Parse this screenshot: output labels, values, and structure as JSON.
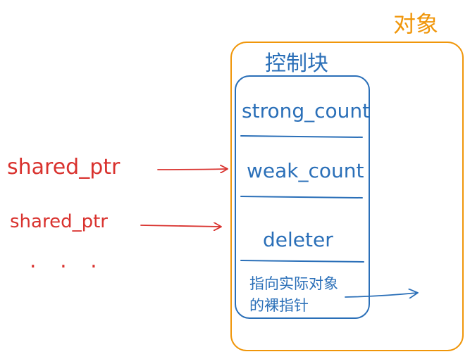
{
  "object_label": "对象",
  "control_block": {
    "title": "控制块",
    "fields": [
      "strong_count",
      "weak_count",
      "deleter"
    ],
    "raw_pointer_note_line1": "指向实际对象",
    "raw_pointer_note_line2": "的裸指针"
  },
  "pointers": [
    "shared_ptr",
    "shared_ptr"
  ],
  "ellipsis": ". . .",
  "colors": {
    "object_border": "#f0960a",
    "control_block_border": "#2a6fb8",
    "text_blue": "#2a6fb8",
    "pointer_red": "#d9322e"
  }
}
